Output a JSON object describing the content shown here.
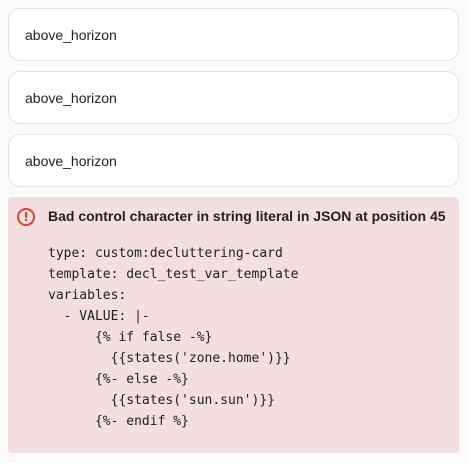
{
  "cards": [
    {
      "label": "above_horizon"
    },
    {
      "label": "above_horizon"
    },
    {
      "label": "above_horizon"
    }
  ],
  "error": {
    "icon": "alert-circle-icon",
    "color": "#db4437",
    "background": "#f3dfe0",
    "title": "Bad control character in string literal in JSON at position 45",
    "lines": [
      "type: custom:decluttering-card",
      "template: decl_test_var_template",
      "variables:",
      "  - VALUE: |-",
      "      {% if false -%}",
      "        {{states('zone.home')}}",
      "      {%- else -%}",
      "        {{states('sun.sun')}}",
      "      {%- endif %}"
    ]
  }
}
